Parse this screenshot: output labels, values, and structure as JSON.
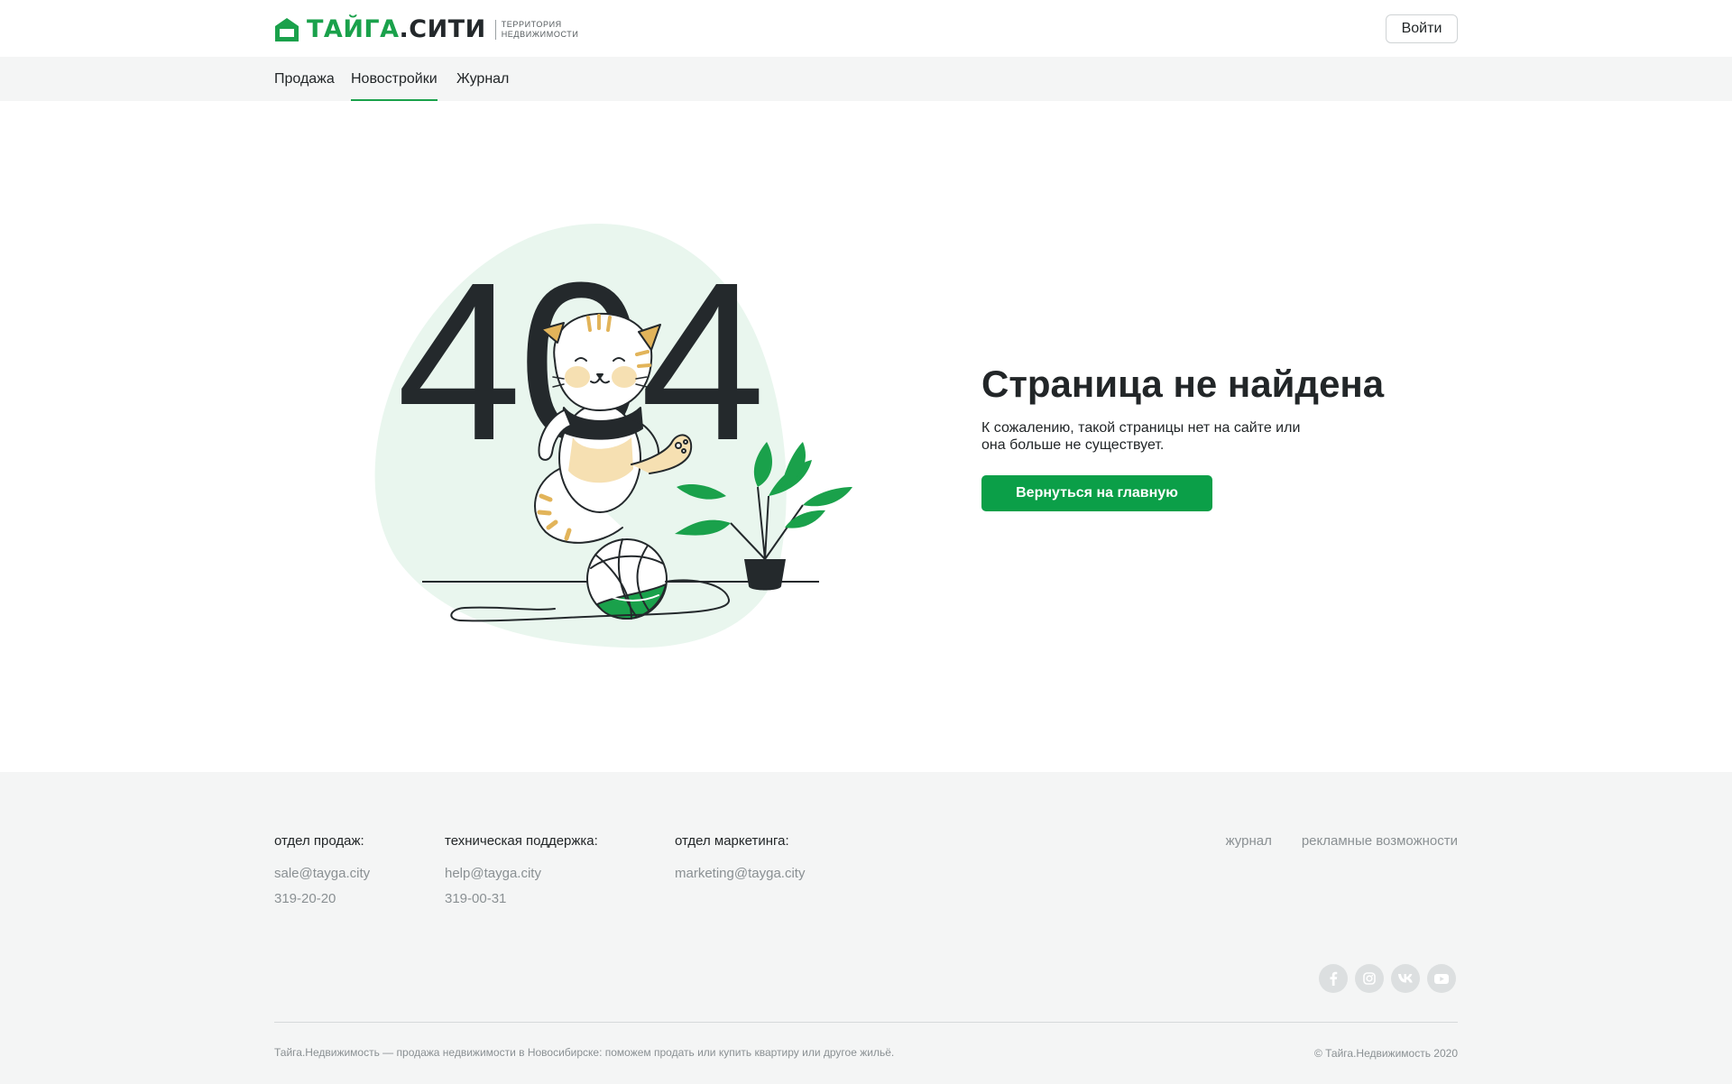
{
  "header": {
    "logo_part1": "ТАЙГА",
    "logo_part2": ".СИТИ",
    "logo_tagline_line1": "ТЕРРИТОРИЯ",
    "logo_tagline_line2": "НЕДВИЖИМОСТИ",
    "login_label": "Войти"
  },
  "nav": {
    "items": [
      {
        "label": "Продажа",
        "active": false
      },
      {
        "label": "Новостройки",
        "active": true
      },
      {
        "label": "Журнал",
        "active": false
      }
    ]
  },
  "error": {
    "code": "404",
    "title": "Страница не найдена",
    "text_line1": "К сожалению, такой страницы нет на сайте или",
    "text_line2": "она больше не существует.",
    "home_button_label": "Вернуться на главную"
  },
  "footer": {
    "sales": {
      "heading": "отдел продаж:",
      "email": "sale@tayga.city",
      "phone": "319-20-20"
    },
    "support": {
      "heading": "техническая поддержка:",
      "email": "help@tayga.city",
      "phone": "319-00-31"
    },
    "marketing": {
      "heading": "отдел маркетинга:",
      "email": "marketing@tayga.city"
    },
    "links": [
      "журнал",
      "рекламные возможности"
    ],
    "socials": [
      "facebook-icon",
      "instagram-icon",
      "vk-icon",
      "youtube-icon"
    ],
    "note": "Тайга.Недвижимость — продажа недвижимости в Новосибирске: поможем продать или купить квартиру или другое жильё.",
    "copyright": "© Тайга.Недвижимость 2020"
  },
  "colors": {
    "brand_green": "#1aa14b",
    "button_green": "#0b9f48",
    "dark_text": "#222628",
    "muted_text": "#8a9093",
    "footer_bg": "#f4f5f5",
    "blob_mint": "#e9f6ee"
  }
}
